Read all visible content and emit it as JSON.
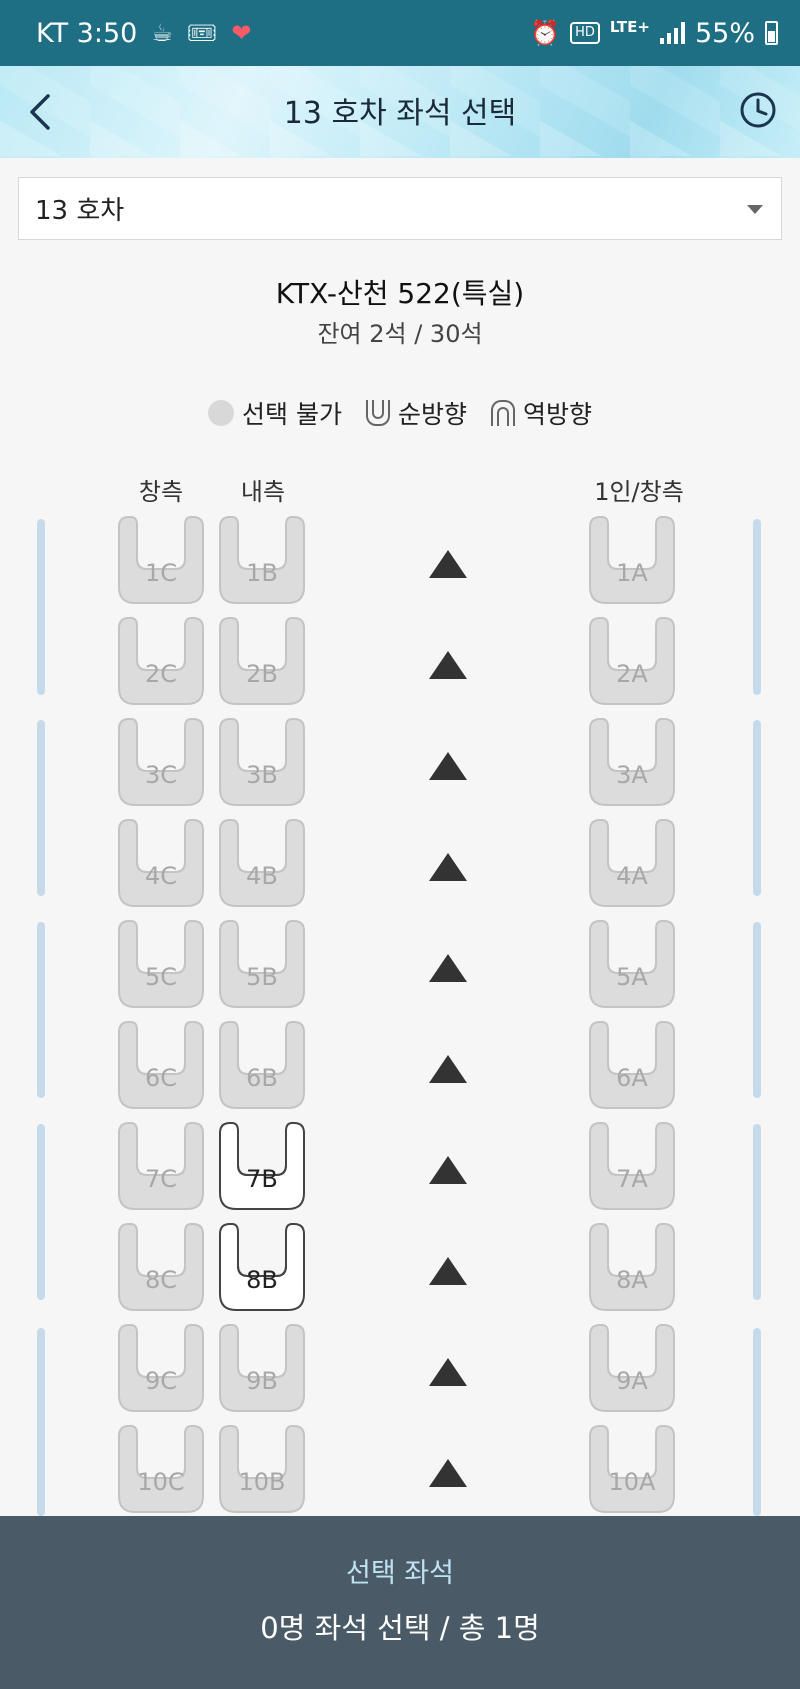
{
  "status": {
    "carrier_time": "KT 3:50",
    "battery": "55%",
    "network": "LTE+",
    "hd": "HD",
    "icons": [
      "coffee-icon",
      "ticket-icon",
      "heart-icon",
      "alarm-icon"
    ]
  },
  "header": {
    "title": "13 호차 좌석 선택"
  },
  "car_select": {
    "value": "13 호차"
  },
  "train": {
    "name": "KTX-산천 522(특실)",
    "remaining": "잔여 2석 / 30석"
  },
  "legend": {
    "unavailable": "선택 불가",
    "forward": "순방향",
    "reverse": "역방향"
  },
  "columns": {
    "window": "창측",
    "aisle": "내측",
    "single_window": "1인/창측"
  },
  "rows": [
    {
      "c": "1C",
      "b": "1B",
      "a": "1A",
      "c_on": false,
      "b_on": false,
      "a_on": false
    },
    {
      "c": "2C",
      "b": "2B",
      "a": "2A",
      "c_on": false,
      "b_on": false,
      "a_on": false
    },
    {
      "c": "3C",
      "b": "3B",
      "a": "3A",
      "c_on": false,
      "b_on": false,
      "a_on": false
    },
    {
      "c": "4C",
      "b": "4B",
      "a": "4A",
      "c_on": false,
      "b_on": false,
      "a_on": false
    },
    {
      "c": "5C",
      "b": "5B",
      "a": "5A",
      "c_on": false,
      "b_on": false,
      "a_on": false
    },
    {
      "c": "6C",
      "b": "6B",
      "a": "6A",
      "c_on": false,
      "b_on": false,
      "a_on": false
    },
    {
      "c": "7C",
      "b": "7B",
      "a": "7A",
      "c_on": false,
      "b_on": true,
      "a_on": false
    },
    {
      "c": "8C",
      "b": "8B",
      "a": "8A",
      "c_on": false,
      "b_on": true,
      "a_on": false
    },
    {
      "c": "9C",
      "b": "9B",
      "a": "9A",
      "c_on": false,
      "b_on": false,
      "a_on": false
    },
    {
      "c": "10C",
      "b": "10B",
      "a": "10A",
      "c_on": false,
      "b_on": false,
      "a_on": false
    }
  ],
  "footer": {
    "title": "선택 좌석",
    "count": "0명 좌석 선택 / 총 1명"
  },
  "colors": {
    "status_bar": "#1e6f83",
    "footer_bg": "#4a5a66",
    "footer_title": "#bfe2f2",
    "seat_unavailable": "#dcdcdc",
    "side_bar": "#c5dbec"
  }
}
